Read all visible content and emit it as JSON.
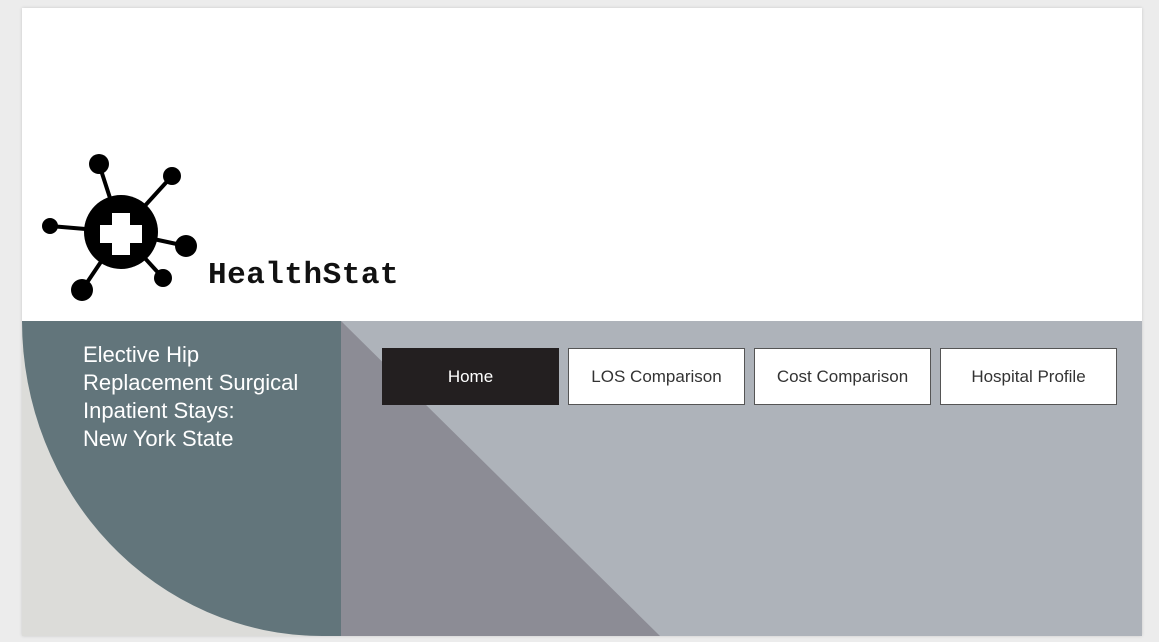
{
  "brand": {
    "name": "HealthStat",
    "logo_icon": "virus-medical-cross-icon"
  },
  "banner": {
    "subtitle_lines": [
      "Elective Hip",
      "Replacement Surgical",
      "Inpatient Stays:",
      "New York State"
    ]
  },
  "nav": {
    "items": [
      {
        "label": "Home",
        "active": true
      },
      {
        "label": "LOS Comparison",
        "active": false
      },
      {
        "label": "Cost Comparison",
        "active": false
      },
      {
        "label": "Hospital Profile",
        "active": false
      }
    ]
  },
  "colors": {
    "banner_bg": "#aeb3ba",
    "teal_panel": "#62757b",
    "light_corner": "#dcdcd9",
    "dark_triangle": "#8c8c95",
    "active_button": "#231f20"
  }
}
